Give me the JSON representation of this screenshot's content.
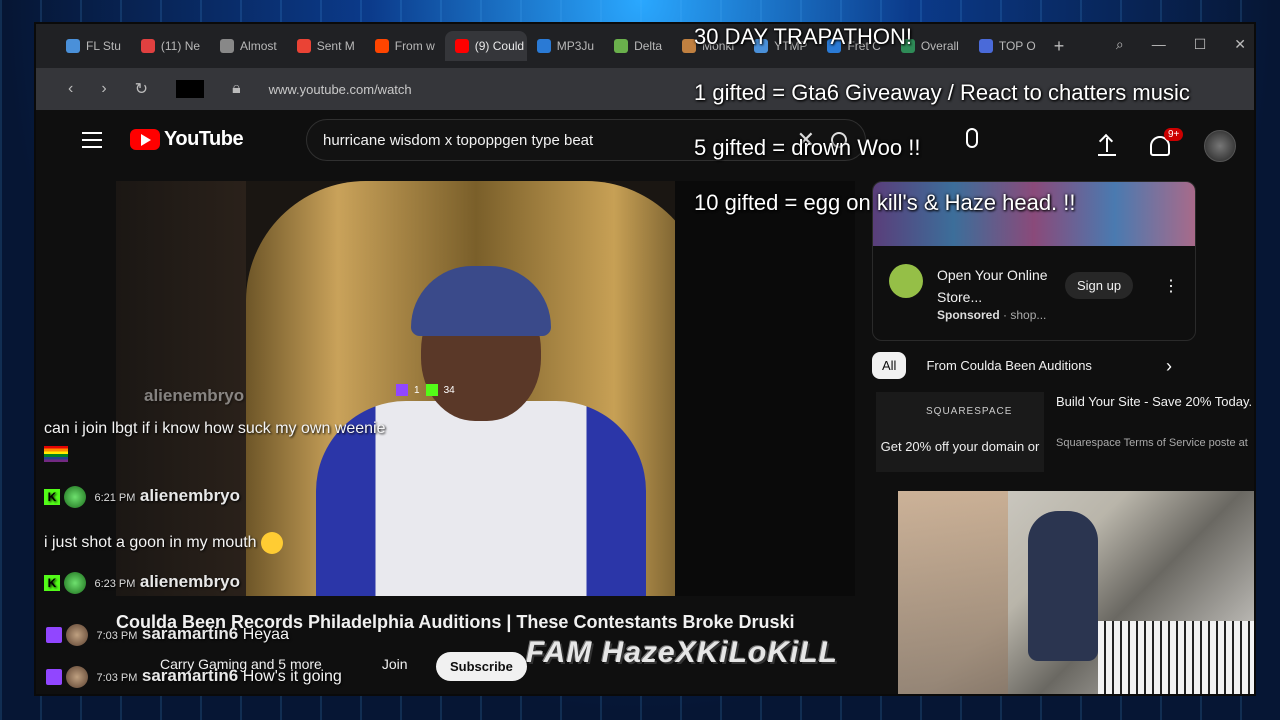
{
  "browser": {
    "tabs": [
      {
        "label": "FL Stu",
        "color": "#4a90d9"
      },
      {
        "label": "(11) Ne",
        "color": "#e04040"
      },
      {
        "label": "Almost",
        "color": "#888888"
      },
      {
        "label": "Sent M",
        "color": "#ea4335"
      },
      {
        "label": "From w",
        "color": "#ff4500"
      },
      {
        "label": "(9) Could",
        "color": "#ff0000",
        "active": true
      },
      {
        "label": "MP3Ju",
        "color": "#2a7ad5"
      },
      {
        "label": "Delta",
        "color": "#6ab04c"
      },
      {
        "label": "Monki",
        "color": "#c08040"
      },
      {
        "label": "YTMP",
        "color": "#4a90d9"
      },
      {
        "label": "Fret C",
        "color": "#2a7ad5"
      },
      {
        "label": "Overall",
        "color": "#2e8b57"
      },
      {
        "label": "TOP O",
        "color": "#4a6ad9"
      }
    ],
    "url": "www.youtube.com/watch"
  },
  "youtube": {
    "logo_text": "YouTube",
    "search_value": "hurricane wisdom x topoppgen type beat",
    "notifications_badge": "9+",
    "video_title": "Coulda Been Records Philadelphia Auditions | These Contestants Broke Druski",
    "channel_line": "Carry Gaming and 5 more",
    "join_label": "Join",
    "subscribe_label": "Subscribe",
    "ad": {
      "title": "Open Your Online Store...",
      "sponsored": "Sponsored",
      "domain": "shop...",
      "cta": "Sign up"
    },
    "chips": {
      "all": "All",
      "from": "From Coulda Been Auditions"
    },
    "rec": {
      "thumb_brand": "SQUARESPACE",
      "thumb_promo": "Get 20% off your domain or",
      "title": "Build Your Site - Save 20% Today.",
      "sub": "Squarespace Terms of Service poste at"
    }
  },
  "overlay": {
    "goals": {
      "title": "30 DAY TRAPATHON!",
      "g1": "1 gifted = Gta6 Giveaway / React to chatters music",
      "g5": "5 gifted = drown Woo  !!",
      "g10": "10 gifted = egg on kill's & Haze head. !!"
    },
    "viewer_counts": {
      "twitch": "1",
      "kick": "34"
    },
    "brand": "FAM HazeXKiLoKiLL"
  },
  "chat": [
    {
      "time": "",
      "user": "alienembryo",
      "msg": "can i join lbgt if i know how suck my own weenie"
    },
    {
      "time": "6:21 PM",
      "user": "alienembryo",
      "msg": "i just shot a goon in my mouth"
    },
    {
      "time": "6:23 PM",
      "user": "alienembryo",
      "msg": ""
    },
    {
      "time": "7:03 PM",
      "user": "saramartin6",
      "msg": "Heyaa"
    },
    {
      "time": "7:03 PM",
      "user": "saramartin6",
      "msg": "How's it going"
    }
  ]
}
